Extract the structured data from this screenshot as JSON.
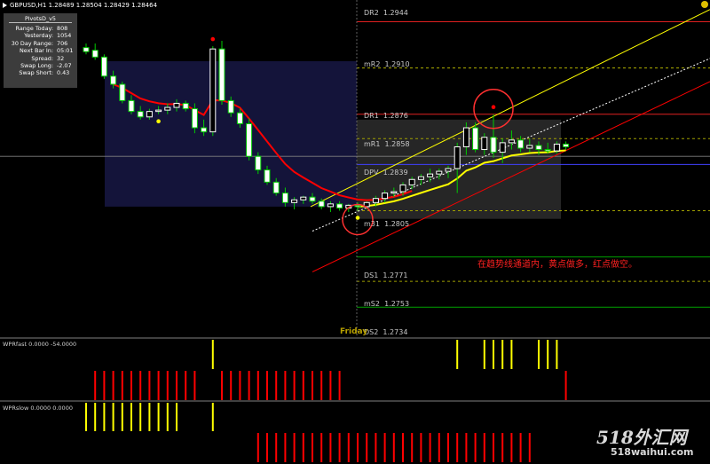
{
  "header": {
    "symbol_line": "GBPUSD,H1  1.28489 1.28504 1.28429 1.28464"
  },
  "info_panel": {
    "title": "PivotsD_v5",
    "rows": [
      {
        "label": "Range Today:",
        "value": "808"
      },
      {
        "label": "Yesterday:",
        "value": "1054"
      },
      {
        "label": "30 Day Range:",
        "value": "706"
      },
      {
        "label": "Next Bar In:",
        "value": "05:01"
      },
      {
        "label": "Spread:",
        "value": "32"
      },
      {
        "label": "Swap Long:",
        "value": "-2.07"
      },
      {
        "label": "Swap Short:",
        "value": "0.43"
      }
    ]
  },
  "pivot_levels": [
    {
      "name": "DR2",
      "value": "1.2944"
    },
    {
      "name": "mR2",
      "value": "1.2910"
    },
    {
      "name": "DR1",
      "value": "1.2876"
    },
    {
      "name": "mR1",
      "value": "1.2858"
    },
    {
      "name": "DPV",
      "value": "1.2839"
    },
    {
      "name": "m31",
      "value": "1.2805"
    },
    {
      "name": "DS1",
      "value": "1.2771"
    },
    {
      "name": "mS2",
      "value": "1.2753"
    },
    {
      "name": "DS2",
      "value": "1.2734"
    }
  ],
  "day_label": "Friday",
  "annotation": "在趋势线通道内，黄点做多，红点做空。",
  "indicators": {
    "wpr_fast": "WPRfast 0.0000 -54.0000",
    "wpr_slow": "WPRslow 0.0000 0.0000"
  },
  "watermark": {
    "cn": "518外汇网",
    "url": "518waihui.com"
  },
  "colors": {
    "bull": "#ffffff",
    "bear": "#ffffff",
    "wick": "#00cc00",
    "ma_red": "#ff0000",
    "ma_yellow": "#ffff00",
    "channel": "#ffff00",
    "channel_lower": "#ff0000",
    "bar_yellow": "#ffff00",
    "bar_red": "#ff0000"
  },
  "chart_data": {
    "type": "candlestick",
    "symbol": "GBPUSD",
    "timeframe": "H1",
    "ylim": [
      1.2712,
      1.296
    ],
    "candles": [
      {
        "o": 1.2925,
        "h": 1.2928,
        "l": 1.292,
        "c": 1.2922
      },
      {
        "o": 1.2923,
        "h": 1.2928,
        "l": 1.2916,
        "c": 1.2918
      },
      {
        "o": 1.2918,
        "h": 1.292,
        "l": 1.2902,
        "c": 1.2904
      },
      {
        "o": 1.2904,
        "h": 1.2908,
        "l": 1.2895,
        "c": 1.2898
      },
      {
        "o": 1.2898,
        "h": 1.29,
        "l": 1.2884,
        "c": 1.2886
      },
      {
        "o": 1.2886,
        "h": 1.289,
        "l": 1.2876,
        "c": 1.2878
      },
      {
        "o": 1.2878,
        "h": 1.2882,
        "l": 1.2872,
        "c": 1.2874
      },
      {
        "o": 1.2874,
        "h": 1.288,
        "l": 1.2872,
        "c": 1.2878
      },
      {
        "o": 1.2878,
        "h": 1.2882,
        "l": 1.2876,
        "c": 1.2879
      },
      {
        "o": 1.2879,
        "h": 1.2884,
        "l": 1.2876,
        "c": 1.2881
      },
      {
        "o": 1.2881,
        "h": 1.2887,
        "l": 1.2878,
        "c": 1.2884
      },
      {
        "o": 1.2884,
        "h": 1.2886,
        "l": 1.2878,
        "c": 1.288
      },
      {
        "o": 1.288,
        "h": 1.2884,
        "l": 1.2862,
        "c": 1.2866
      },
      {
        "o": 1.2866,
        "h": 1.2872,
        "l": 1.286,
        "c": 1.2863
      },
      {
        "o": 1.2863,
        "h": 1.2926,
        "l": 1.286,
        "c": 1.2924
      },
      {
        "o": 1.2924,
        "h": 1.293,
        "l": 1.2883,
        "c": 1.2886
      },
      {
        "o": 1.2886,
        "h": 1.2889,
        "l": 1.2874,
        "c": 1.2877
      },
      {
        "o": 1.2877,
        "h": 1.288,
        "l": 1.2866,
        "c": 1.2869
      },
      {
        "o": 1.2869,
        "h": 1.2873,
        "l": 1.2842,
        "c": 1.2845
      },
      {
        "o": 1.2845,
        "h": 1.2848,
        "l": 1.2832,
        "c": 1.2835
      },
      {
        "o": 1.2835,
        "h": 1.2838,
        "l": 1.2824,
        "c": 1.2826
      },
      {
        "o": 1.2826,
        "h": 1.2829,
        "l": 1.2816,
        "c": 1.2818
      },
      {
        "o": 1.2818,
        "h": 1.2822,
        "l": 1.2808,
        "c": 1.2811
      },
      {
        "o": 1.2811,
        "h": 1.2815,
        "l": 1.2806,
        "c": 1.2813
      },
      {
        "o": 1.2813,
        "h": 1.2816,
        "l": 1.281,
        "c": 1.2815
      },
      {
        "o": 1.2815,
        "h": 1.2818,
        "l": 1.281,
        "c": 1.2812
      },
      {
        "o": 1.2812,
        "h": 1.2814,
        "l": 1.2806,
        "c": 1.2808
      },
      {
        "o": 1.2808,
        "h": 1.2812,
        "l": 1.2804,
        "c": 1.281
      },
      {
        "o": 1.281,
        "h": 1.2812,
        "l": 1.2805,
        "c": 1.2807
      },
      {
        "o": 1.2807,
        "h": 1.281,
        "l": 1.2804,
        "c": 1.2809
      },
      {
        "o": 1.2809,
        "h": 1.2811,
        "l": 1.2805,
        "c": 1.2808
      },
      {
        "o": 1.2808,
        "h": 1.2812,
        "l": 1.2806,
        "c": 1.2811
      },
      {
        "o": 1.2811,
        "h": 1.2816,
        "l": 1.2808,
        "c": 1.2814
      },
      {
        "o": 1.2814,
        "h": 1.282,
        "l": 1.2811,
        "c": 1.2818
      },
      {
        "o": 1.2818,
        "h": 1.2822,
        "l": 1.2815,
        "c": 1.2819
      },
      {
        "o": 1.2819,
        "h": 1.2826,
        "l": 1.2816,
        "c": 1.2824
      },
      {
        "o": 1.2824,
        "h": 1.283,
        "l": 1.2821,
        "c": 1.2828
      },
      {
        "o": 1.2828,
        "h": 1.2832,
        "l": 1.2824,
        "c": 1.283
      },
      {
        "o": 1.283,
        "h": 1.2836,
        "l": 1.2826,
        "c": 1.2832
      },
      {
        "o": 1.2832,
        "h": 1.2836,
        "l": 1.2828,
        "c": 1.2834
      },
      {
        "o": 1.2834,
        "h": 1.2838,
        "l": 1.2829,
        "c": 1.2836
      },
      {
        "o": 1.2836,
        "h": 1.2855,
        "l": 1.2818,
        "c": 1.2852
      },
      {
        "o": 1.2852,
        "h": 1.287,
        "l": 1.2846,
        "c": 1.2866
      },
      {
        "o": 1.2866,
        "h": 1.287,
        "l": 1.2848,
        "c": 1.285
      },
      {
        "o": 1.285,
        "h": 1.2862,
        "l": 1.2846,
        "c": 1.2859
      },
      {
        "o": 1.2859,
        "h": 1.2876,
        "l": 1.2844,
        "c": 1.2848
      },
      {
        "o": 1.2848,
        "h": 1.2858,
        "l": 1.284,
        "c": 1.2855
      },
      {
        "o": 1.2855,
        "h": 1.2864,
        "l": 1.285,
        "c": 1.2857
      },
      {
        "o": 1.2857,
        "h": 1.286,
        "l": 1.2848,
        "c": 1.2851
      },
      {
        "o": 1.2851,
        "h": 1.2858,
        "l": 1.2848,
        "c": 1.2853
      },
      {
        "o": 1.2853,
        "h": 1.2856,
        "l": 1.2846,
        "c": 1.285
      },
      {
        "o": 1.285,
        "h": 1.2855,
        "l": 1.2847,
        "c": 1.2849
      },
      {
        "o": 1.2849,
        "h": 1.2856,
        "l": 1.2847,
        "c": 1.2854
      },
      {
        "o": 1.2854,
        "h": 1.2856,
        "l": 1.285,
        "c": 1.2852
      }
    ],
    "signals": [
      {
        "bar": 8,
        "kind": "buy"
      },
      {
        "bar": 14,
        "kind": "sell"
      },
      {
        "bar": 30,
        "kind": "buy"
      },
      {
        "bar": 45,
        "kind": "sell"
      }
    ],
    "wpr_fast": {
      "yellow": [
        14,
        41,
        44,
        45,
        46,
        47,
        50,
        51,
        52
      ],
      "red": [
        1,
        2,
        3,
        4,
        5,
        6,
        7,
        8,
        9,
        10,
        11,
        12,
        15,
        16,
        17,
        18,
        19,
        20,
        21,
        22,
        23,
        24,
        25,
        26,
        27,
        28,
        53
      ]
    },
    "wpr_slow": {
      "yellow": [
        0,
        1,
        2,
        3,
        4,
        5,
        6,
        7,
        8,
        9,
        10,
        14
      ],
      "red": [
        19,
        20,
        21,
        22,
        23,
        24,
        25,
        26,
        27,
        28,
        29,
        30,
        31,
        32,
        33,
        34,
        35,
        36,
        37,
        38,
        39,
        40,
        41,
        42,
        43,
        44,
        45,
        46,
        47,
        48,
        49
      ]
    }
  }
}
